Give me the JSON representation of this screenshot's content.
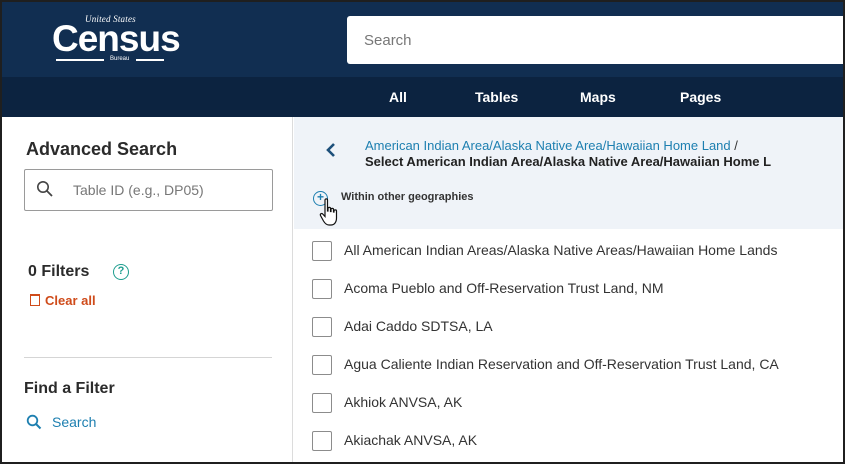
{
  "logo": {
    "top_text": "United States",
    "main_text": "Census",
    "bottom_text": "Bureau"
  },
  "header": {
    "search_placeholder": "Search"
  },
  "tabs": [
    {
      "label": "All"
    },
    {
      "label": "Tables"
    },
    {
      "label": "Maps"
    },
    {
      "label": "Pages"
    }
  ],
  "sidebar": {
    "title": "Advanced Search",
    "table_id_placeholder": "Table ID (e.g., DP05)",
    "filters_label": "0 Filters",
    "clear_all_label": "Clear all",
    "find_filter_title": "Find a Filter",
    "find_filter_search": "Search"
  },
  "main": {
    "breadcrumb_link": "American Indian Area/Alaska Native Area/Hawaiian Home Land",
    "breadcrumb_sep": "/",
    "breadcrumb_current": "Select American Indian Area/Alaska Native Area/Hawaiian Home L",
    "within_label": "Within other geographies",
    "items": [
      "All American Indian Areas/Alaska Native Areas/Hawaiian Home Lands",
      "Acoma Pueblo and Off-Reservation Trust Land, NM",
      "Adai Caddo SDTSA, LA",
      "Agua Caliente Indian Reservation and Off-Reservation Trust Land, CA",
      "Akhiok ANVSA, AK",
      "Akiachak ANVSA, AK"
    ]
  },
  "colors": {
    "header_bg": "#112e51",
    "tabbar_bg": "#0c2340",
    "link": "#1d7fb0",
    "clear_all": "#cf4b1a",
    "help": "#1e9e8f"
  }
}
